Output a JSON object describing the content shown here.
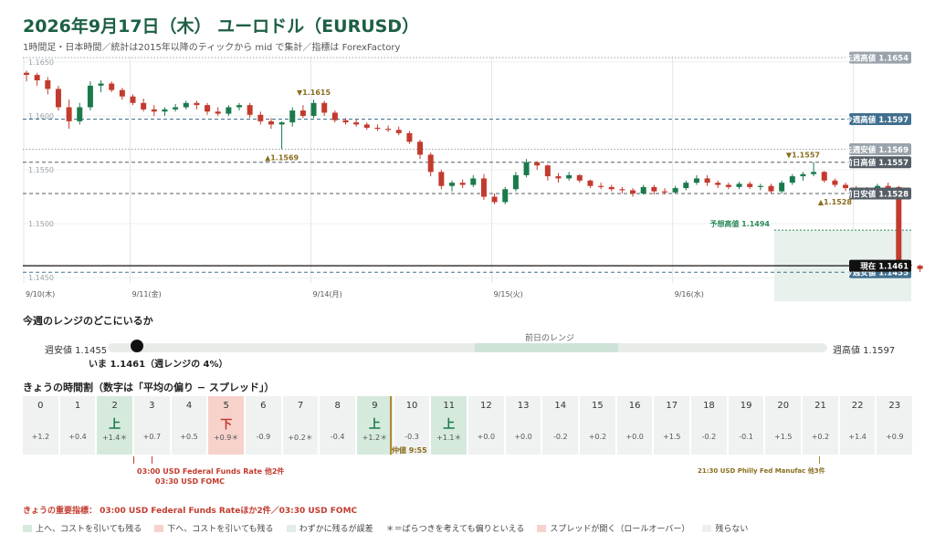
{
  "page": {
    "title": "2026年9月17日（木） ユーロドル（EURUSD）",
    "subtitle": "1時間足・日本時間／統計は2015年以降のティックから mid で集計／指標は ForexFactory"
  },
  "chart_data": {
    "type": "candlestick",
    "ylim": [
      1.1445,
      1.1655
    ],
    "yticks": [
      1.145,
      1.15,
      1.155,
      1.16,
      1.165
    ],
    "ytick_labels": [
      "1.1450",
      "1.1500",
      "1.1550",
      "1.1600",
      "1.1650"
    ],
    "day_labels": [
      {
        "bar": 0,
        "label": "9/10(木)"
      },
      {
        "bar": 10,
        "label": "9/11(金)"
      },
      {
        "bar": 27,
        "label": "9/14(月)"
      },
      {
        "bar": 44,
        "label": "9/15(火)"
      },
      {
        "bar": 61,
        "label": "9/16(水)"
      },
      {
        "bar": 78,
        "label": "9/"
      }
    ],
    "candles": [
      {
        "o": 1.164,
        "h": 1.1642,
        "l": 1.1632,
        "c": 1.1638
      },
      {
        "o": 1.1638,
        "h": 1.164,
        "l": 1.1628,
        "c": 1.1633
      },
      {
        "o": 1.1633,
        "h": 1.1636,
        "l": 1.162,
        "c": 1.1625
      },
      {
        "o": 1.1625,
        "h": 1.1628,
        "l": 1.1605,
        "c": 1.1608
      },
      {
        "o": 1.1608,
        "h": 1.1615,
        "l": 1.1588,
        "c": 1.1595
      },
      {
        "o": 1.1595,
        "h": 1.1612,
        "l": 1.1592,
        "c": 1.1608
      },
      {
        "o": 1.1608,
        "h": 1.1632,
        "l": 1.1605,
        "c": 1.1628
      },
      {
        "o": 1.1628,
        "h": 1.1633,
        "l": 1.1622,
        "c": 1.163
      },
      {
        "o": 1.163,
        "h": 1.1632,
        "l": 1.1622,
        "c": 1.1624
      },
      {
        "o": 1.1624,
        "h": 1.1626,
        "l": 1.1615,
        "c": 1.1618
      },
      {
        "o": 1.1618,
        "h": 1.162,
        "l": 1.161,
        "c": 1.1612
      },
      {
        "o": 1.1612,
        "h": 1.1616,
        "l": 1.1604,
        "c": 1.1606
      },
      {
        "o": 1.1606,
        "h": 1.161,
        "l": 1.16,
        "c": 1.1604
      },
      {
        "o": 1.1604,
        "h": 1.1608,
        "l": 1.16,
        "c": 1.1606
      },
      {
        "o": 1.1606,
        "h": 1.1611,
        "l": 1.1604,
        "c": 1.1608
      },
      {
        "o": 1.1608,
        "h": 1.1614,
        "l": 1.1606,
        "c": 1.1612
      },
      {
        "o": 1.1612,
        "h": 1.1614,
        "l": 1.1606,
        "c": 1.161
      },
      {
        "o": 1.161,
        "h": 1.1612,
        "l": 1.1601,
        "c": 1.1604
      },
      {
        "o": 1.1604,
        "h": 1.1608,
        "l": 1.16,
        "c": 1.1602
      },
      {
        "o": 1.1602,
        "h": 1.161,
        "l": 1.16,
        "c": 1.1608
      },
      {
        "o": 1.1608,
        "h": 1.1612,
        "l": 1.1605,
        "c": 1.161
      },
      {
        "o": 1.161,
        "h": 1.1612,
        "l": 1.1598,
        "c": 1.1601
      },
      {
        "o": 1.1601,
        "h": 1.1604,
        "l": 1.1592,
        "c": 1.1595
      },
      {
        "o": 1.1595,
        "h": 1.1598,
        "l": 1.1588,
        "c": 1.1592
      },
      {
        "o": 1.1592,
        "h": 1.1595,
        "l": 1.1569,
        "c": 1.1594
      },
      {
        "o": 1.1594,
        "h": 1.1608,
        "l": 1.159,
        "c": 1.1605
      },
      {
        "o": 1.1605,
        "h": 1.161,
        "l": 1.1598,
        "c": 1.16
      },
      {
        "o": 1.16,
        "h": 1.1615,
        "l": 1.1598,
        "c": 1.1612
      },
      {
        "o": 1.1612,
        "h": 1.1614,
        "l": 1.16,
        "c": 1.1603
      },
      {
        "o": 1.1603,
        "h": 1.1605,
        "l": 1.1594,
        "c": 1.1596
      },
      {
        "o": 1.1596,
        "h": 1.1598,
        "l": 1.1592,
        "c": 1.1594
      },
      {
        "o": 1.1594,
        "h": 1.1597,
        "l": 1.159,
        "c": 1.1592
      },
      {
        "o": 1.1592,
        "h": 1.1594,
        "l": 1.1587,
        "c": 1.1589
      },
      {
        "o": 1.1589,
        "h": 1.1592,
        "l": 1.1586,
        "c": 1.1588
      },
      {
        "o": 1.1588,
        "h": 1.1591,
        "l": 1.1585,
        "c": 1.1587
      },
      {
        "o": 1.1587,
        "h": 1.159,
        "l": 1.1582,
        "c": 1.1584
      },
      {
        "o": 1.1584,
        "h": 1.1586,
        "l": 1.1574,
        "c": 1.1576
      },
      {
        "o": 1.1576,
        "h": 1.1578,
        "l": 1.156,
        "c": 1.1564
      },
      {
        "o": 1.1564,
        "h": 1.1566,
        "l": 1.1544,
        "c": 1.1548
      },
      {
        "o": 1.1548,
        "h": 1.155,
        "l": 1.1532,
        "c": 1.1535
      },
      {
        "o": 1.1535,
        "h": 1.154,
        "l": 1.153,
        "c": 1.1538
      },
      {
        "o": 1.1538,
        "h": 1.1541,
        "l": 1.1533,
        "c": 1.1536
      },
      {
        "o": 1.1536,
        "h": 1.1545,
        "l": 1.1534,
        "c": 1.1542
      },
      {
        "o": 1.1542,
        "h": 1.1546,
        "l": 1.1522,
        "c": 1.1525
      },
      {
        "o": 1.1525,
        "h": 1.1528,
        "l": 1.1518,
        "c": 1.152
      },
      {
        "o": 1.152,
        "h": 1.1534,
        "l": 1.1518,
        "c": 1.1532
      },
      {
        "o": 1.1532,
        "h": 1.1548,
        "l": 1.153,
        "c": 1.1545
      },
      {
        "o": 1.1545,
        "h": 1.156,
        "l": 1.1543,
        "c": 1.1557
      },
      {
        "o": 1.1557,
        "h": 1.1558,
        "l": 1.155,
        "c": 1.1554
      },
      {
        "o": 1.1554,
        "h": 1.1555,
        "l": 1.154,
        "c": 1.1544
      },
      {
        "o": 1.1544,
        "h": 1.1547,
        "l": 1.1538,
        "c": 1.1542
      },
      {
        "o": 1.1542,
        "h": 1.1548,
        "l": 1.154,
        "c": 1.1545
      },
      {
        "o": 1.1545,
        "h": 1.1546,
        "l": 1.1538,
        "c": 1.154
      },
      {
        "o": 1.154,
        "h": 1.1541,
        "l": 1.1533,
        "c": 1.1535
      },
      {
        "o": 1.1535,
        "h": 1.1538,
        "l": 1.1532,
        "c": 1.1534
      },
      {
        "o": 1.1534,
        "h": 1.1536,
        "l": 1.153,
        "c": 1.1532
      },
      {
        "o": 1.1532,
        "h": 1.1534,
        "l": 1.1528,
        "c": 1.1531
      },
      {
        "o": 1.1531,
        "h": 1.1533,
        "l": 1.1525,
        "c": 1.1528
      },
      {
        "o": 1.1528,
        "h": 1.1536,
        "l": 1.1527,
        "c": 1.1534
      },
      {
        "o": 1.1534,
        "h": 1.1536,
        "l": 1.1527,
        "c": 1.153
      },
      {
        "o": 1.153,
        "h": 1.1533,
        "l": 1.1527,
        "c": 1.1529
      },
      {
        "o": 1.1529,
        "h": 1.1535,
        "l": 1.1528,
        "c": 1.1533
      },
      {
        "o": 1.1533,
        "h": 1.154,
        "l": 1.1531,
        "c": 1.1538
      },
      {
        "o": 1.1538,
        "h": 1.1545,
        "l": 1.1536,
        "c": 1.1542
      },
      {
        "o": 1.1542,
        "h": 1.1545,
        "l": 1.1535,
        "c": 1.1538
      },
      {
        "o": 1.1538,
        "h": 1.154,
        "l": 1.1533,
        "c": 1.1536
      },
      {
        "o": 1.1536,
        "h": 1.1538,
        "l": 1.1532,
        "c": 1.1534
      },
      {
        "o": 1.1534,
        "h": 1.1539,
        "l": 1.1532,
        "c": 1.1537
      },
      {
        "o": 1.1537,
        "h": 1.1539,
        "l": 1.1532,
        "c": 1.1534
      },
      {
        "o": 1.1534,
        "h": 1.1537,
        "l": 1.1531,
        "c": 1.1535
      },
      {
        "o": 1.1535,
        "h": 1.1537,
        "l": 1.1528,
        "c": 1.153
      },
      {
        "o": 1.153,
        "h": 1.154,
        "l": 1.1528,
        "c": 1.1538
      },
      {
        "o": 1.1538,
        "h": 1.1546,
        "l": 1.1536,
        "c": 1.1544
      },
      {
        "o": 1.1544,
        "h": 1.1548,
        "l": 1.154,
        "c": 1.1546
      },
      {
        "o": 1.1546,
        "h": 1.1557,
        "l": 1.1544,
        "c": 1.1548
      },
      {
        "o": 1.1548,
        "h": 1.1549,
        "l": 1.1538,
        "c": 1.154
      },
      {
        "o": 1.154,
        "h": 1.1542,
        "l": 1.1534,
        "c": 1.1536
      },
      {
        "o": 1.1536,
        "h": 1.1538,
        "l": 1.153,
        "c": 1.1533
      },
      {
        "o": 1.1533,
        "h": 1.1535,
        "l": 1.1528,
        "c": 1.1531
      },
      {
        "o": 1.1531,
        "h": 1.1534,
        "l": 1.1528,
        "c": 1.1532
      },
      {
        "o": 1.1532,
        "h": 1.1537,
        "l": 1.153,
        "c": 1.1535
      },
      {
        "o": 1.1535,
        "h": 1.1538,
        "l": 1.1528,
        "c": 1.153
      },
      {
        "o": 1.1534,
        "h": 1.1535,
        "l": 1.1458,
        "c": 1.1462
      },
      {
        "o": 1.1462,
        "h": 1.1465,
        "l": 1.1455,
        "c": 1.1461
      },
      {
        "o": 1.1461,
        "h": 1.1462,
        "l": 1.1455,
        "c": 1.1458
      }
    ],
    "hlines": [
      {
        "value": 1.1654,
        "label": "先週高値 1.1654",
        "style": "dotted",
        "color": "#9aa3ab"
      },
      {
        "value": 1.1597,
        "label": "今週高値 1.1597",
        "style": "dashed",
        "color": "#41708f"
      },
      {
        "value": 1.1569,
        "label": "先週安値 1.1569",
        "style": "dotted",
        "color": "#9aa3ab"
      },
      {
        "value": 1.1557,
        "label": "前日高値 1.1557",
        "style": "dashed",
        "color": "#555d66"
      },
      {
        "value": 1.1528,
        "label": "前日安値 1.1528",
        "style": "dashed",
        "color": "#555d66"
      },
      {
        "value": 1.1455,
        "label": "今週安値 1.1455",
        "style": "dashed",
        "color": "#41708f"
      },
      {
        "value": 1.1461,
        "label": "現在 1.1461",
        "style": "solid",
        "color": "#111111"
      }
    ],
    "forecast": {
      "label": "予想高値 1.1494",
      "value": 1.1494
    },
    "annotations": [
      {
        "bar": 27,
        "value": 1.1615,
        "label": "▼1.1615",
        "pos": "above"
      },
      {
        "bar": 24,
        "value": 1.1569,
        "label": "▲1.1569",
        "pos": "below"
      },
      {
        "bar": 73,
        "value": 1.1557,
        "label": "▼1.1557",
        "pos": "above"
      },
      {
        "bar": 76,
        "value": 1.1528,
        "label": "▲1.1528",
        "pos": "below"
      }
    ],
    "colors": {
      "up": "#1a7a4c",
      "down": "#c23b2e",
      "forecast": "#2b8a5a",
      "annot": "#8a6d1d"
    }
  },
  "range": {
    "title": "今週のレンジのどこにいるか",
    "low_label": "週安値 1.1455",
    "high_label": "週高値 1.1597",
    "prev_label": "前日のレンジ",
    "now_label": "いま 1.1461（週レンジの 4%）",
    "position_percent": 4,
    "prev_range_percent": [
      51,
      71
    ]
  },
  "hours": {
    "title": "きょうの時間割（数字は「平均の偏り − スプレッド」）",
    "cells": [
      {
        "h": "0",
        "sig": "",
        "v": "+1.2",
        "cls": ""
      },
      {
        "h": "1",
        "sig": "",
        "v": "+0.4",
        "cls": ""
      },
      {
        "h": "2",
        "sig": "上",
        "v": "+1.4＊",
        "cls": "up"
      },
      {
        "h": "3",
        "sig": "",
        "v": "+0.7",
        "cls": ""
      },
      {
        "h": "4",
        "sig": "",
        "v": "+0.5",
        "cls": ""
      },
      {
        "h": "5",
        "sig": "下",
        "v": "+0.9＊",
        "cls": "down"
      },
      {
        "h": "6",
        "sig": "",
        "v": "-0.9",
        "cls": ""
      },
      {
        "h": "7",
        "sig": "",
        "v": "+0.2＊",
        "cls": ""
      },
      {
        "h": "8",
        "sig": "",
        "v": "-0.4",
        "cls": ""
      },
      {
        "h": "9",
        "sig": "上",
        "v": "+1.2＊",
        "cls": "up"
      },
      {
        "h": "10",
        "sig": "",
        "v": "-0.3",
        "cls": ""
      },
      {
        "h": "11",
        "sig": "上",
        "v": "+1.1＊",
        "cls": "up"
      },
      {
        "h": "12",
        "sig": "",
        "v": "+0.0",
        "cls": ""
      },
      {
        "h": "13",
        "sig": "",
        "v": "+0.0",
        "cls": ""
      },
      {
        "h": "14",
        "sig": "",
        "v": "-0.2",
        "cls": ""
      },
      {
        "h": "15",
        "sig": "",
        "v": "+0.2",
        "cls": ""
      },
      {
        "h": "16",
        "sig": "",
        "v": "+0.0",
        "cls": ""
      },
      {
        "h": "17",
        "sig": "",
        "v": "+1.5",
        "cls": ""
      },
      {
        "h": "18",
        "sig": "",
        "v": "-0.2",
        "cls": ""
      },
      {
        "h": "19",
        "sig": "",
        "v": "-0.1",
        "cls": ""
      },
      {
        "h": "20",
        "sig": "",
        "v": "+1.5",
        "cls": ""
      },
      {
        "h": "21",
        "sig": "",
        "v": "+0.2",
        "cls": ""
      },
      {
        "h": "22",
        "sig": "",
        "v": "+1.4",
        "cls": ""
      },
      {
        "h": "23",
        "sig": "",
        "v": "+0.9",
        "cls": ""
      }
    ],
    "nakane_label": "仲値 9:55",
    "event1_line1": "03:00 USD Federal Funds Rate 他2件",
    "event1_line2": "03:30 USD FOMC",
    "event2": "21:30 USD Philly Fed Manufac 他3件"
  },
  "footer": {
    "important": "きょうの重要指標： 03:00 USD Federal Funds Rateほか2件／03:30 USD FOMC",
    "legend": [
      {
        "label": "上へ、コストを引いても残る",
        "color": "#d5eadd"
      },
      {
        "label": "下へ、コストを引いても残る",
        "color": "#f6d2cb"
      },
      {
        "label": "わずかに残るが誤差",
        "color": "#e3ece6"
      },
      {
        "label": "＊＝ばらつきを考えても偏りといえる",
        "color": ""
      },
      {
        "label": "スプレッドが開く（ロールオーバー）",
        "color": "#f6d2cb"
      },
      {
        "label": "残らない",
        "color": "#eef0ef"
      }
    ]
  }
}
